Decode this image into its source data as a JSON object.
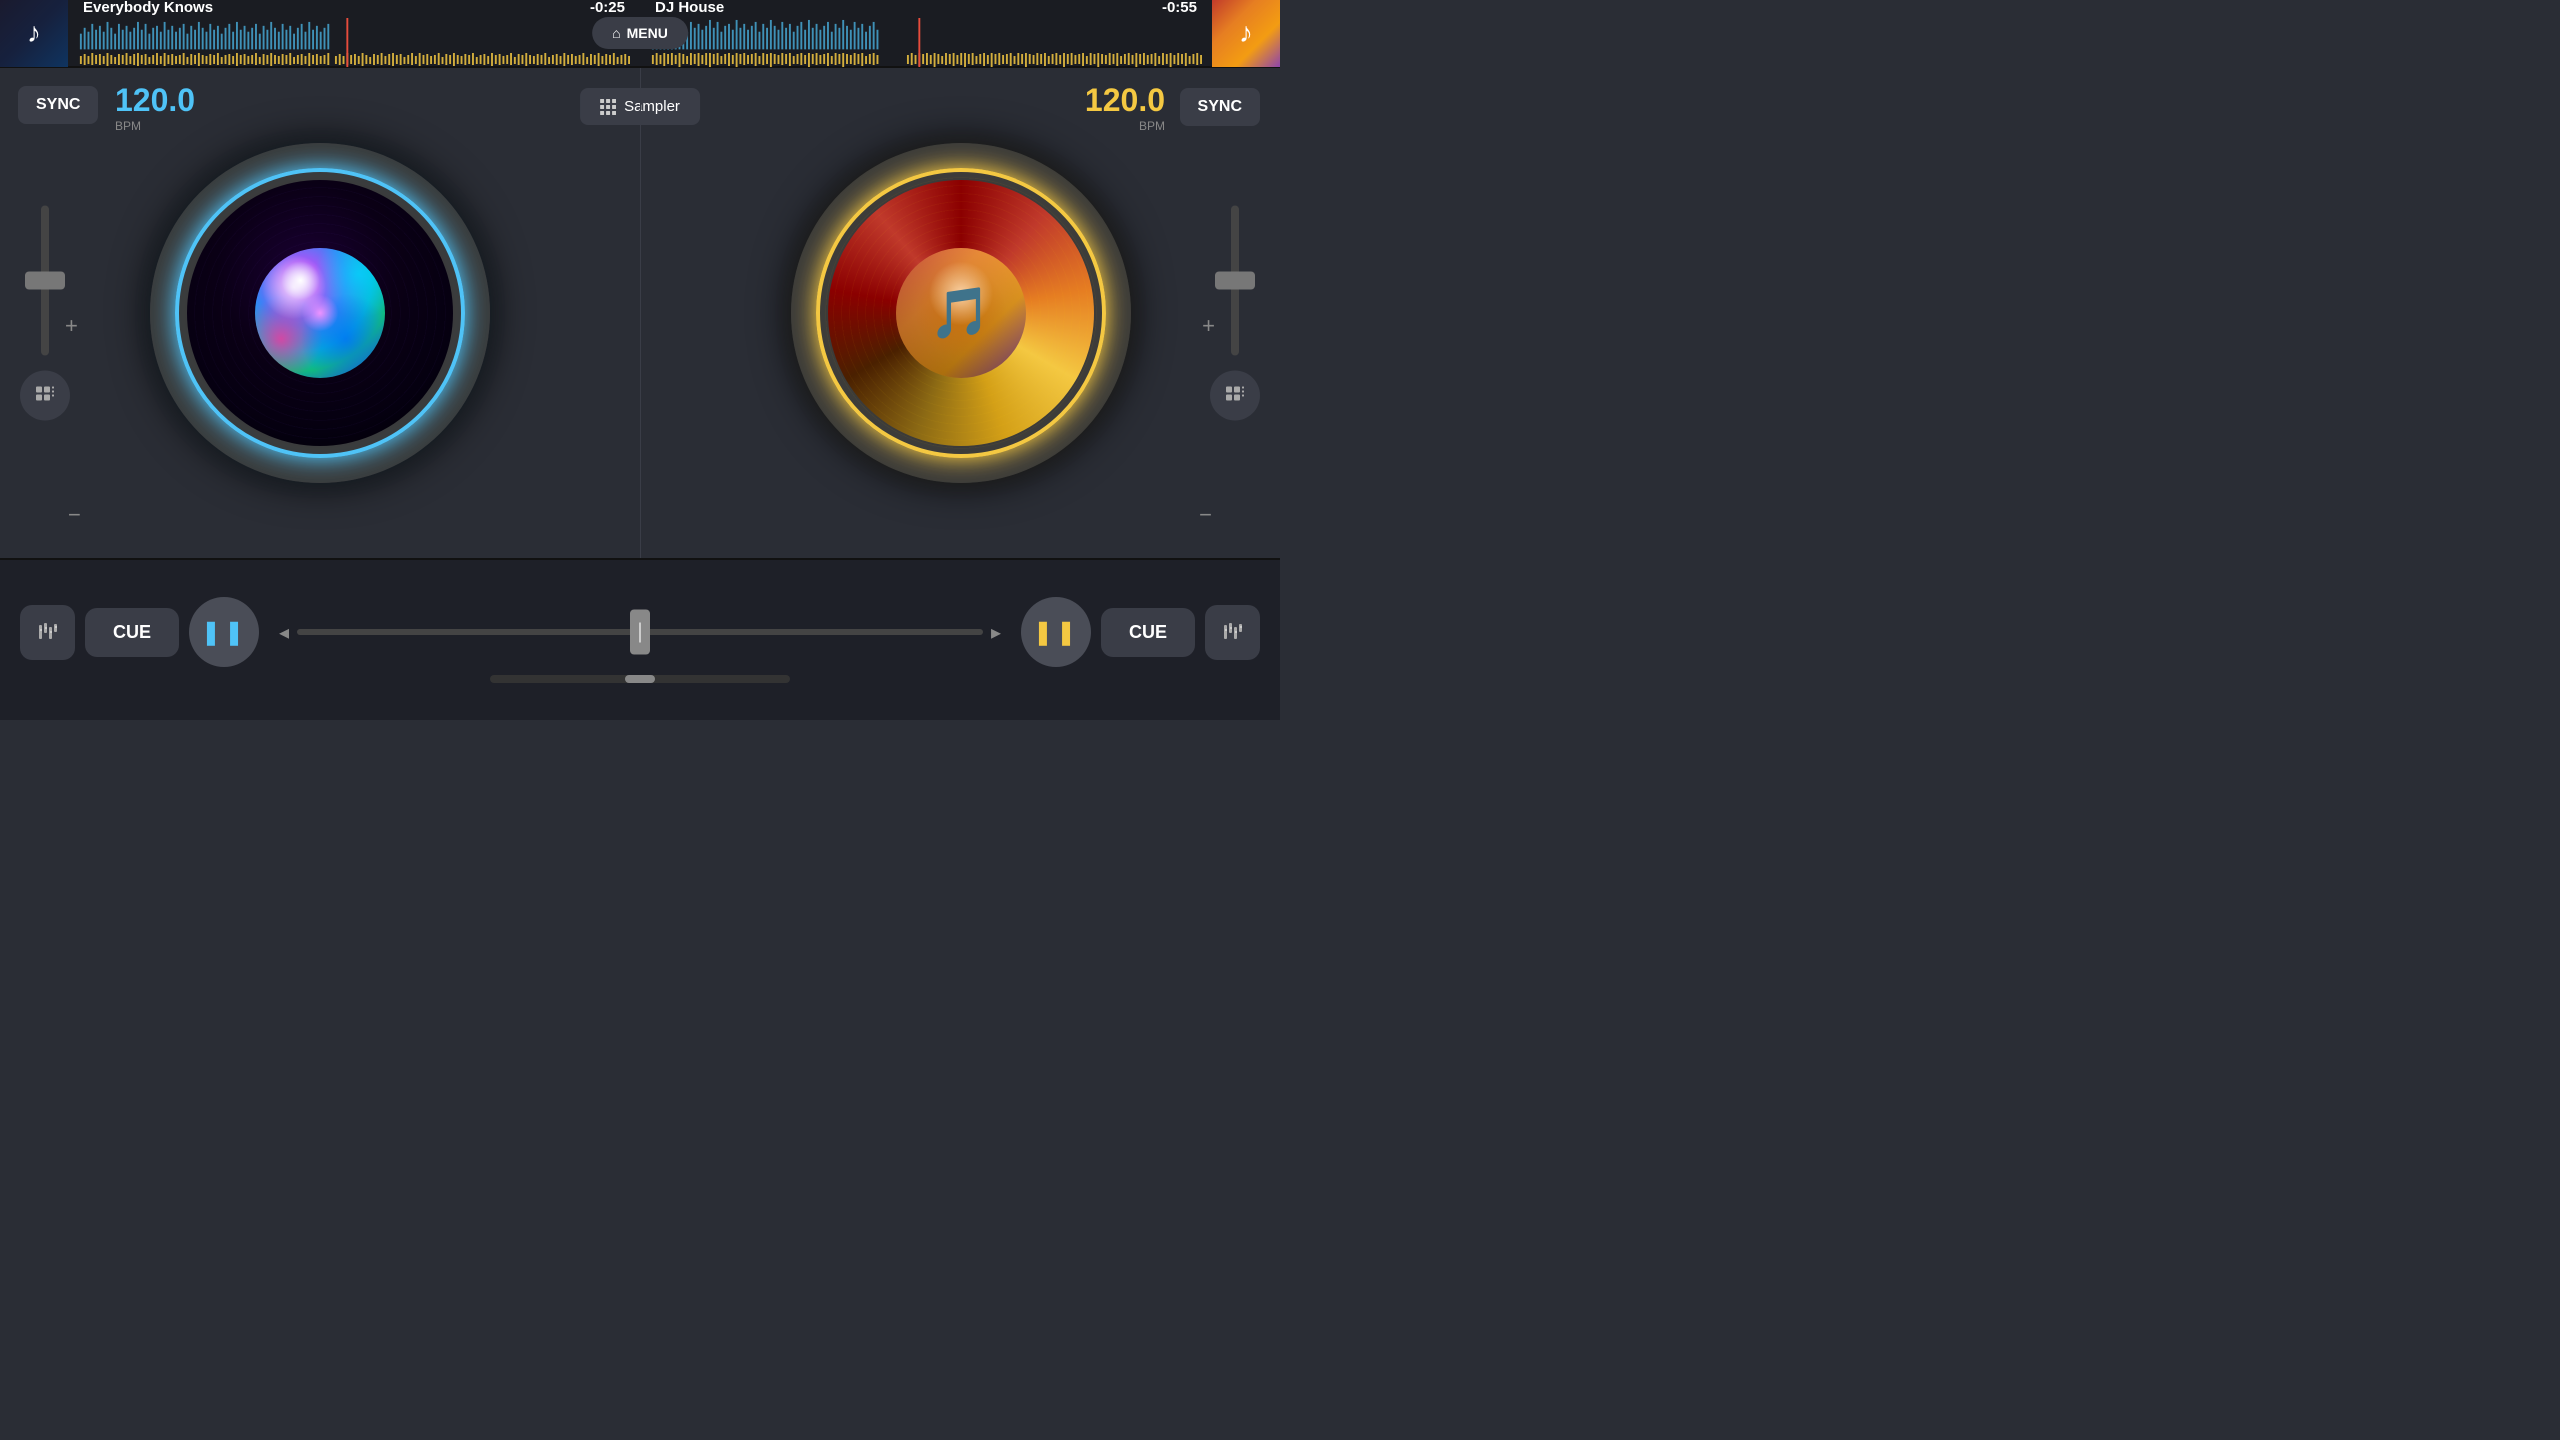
{
  "header": {
    "left_track": {
      "title": "Everybody Knows",
      "time": "-0:25"
    },
    "right_track": {
      "title": "DJ House",
      "time": "-0:55"
    },
    "menu_label": "MENU"
  },
  "left_deck": {
    "sync_label": "SYNC",
    "bpm_value": "120.0",
    "bpm_label": "BPM",
    "cue_label": "CUE",
    "pause_bars": "⏸",
    "plus_label": "+",
    "minus_label": "−"
  },
  "right_deck": {
    "sync_label": "SYNC",
    "bpm_value": "120.0",
    "bpm_label": "BPM",
    "cue_label": "CUE",
    "pause_bars": "⏸",
    "plus_label": "+",
    "minus_label": "−"
  },
  "center": {
    "sampler_label": "Sampler"
  },
  "bottom": {
    "left_eq_icon": "⊟",
    "right_eq_icon": "⊟",
    "left_grid_icon": "⊞",
    "right_grid_icon": "⊞"
  }
}
